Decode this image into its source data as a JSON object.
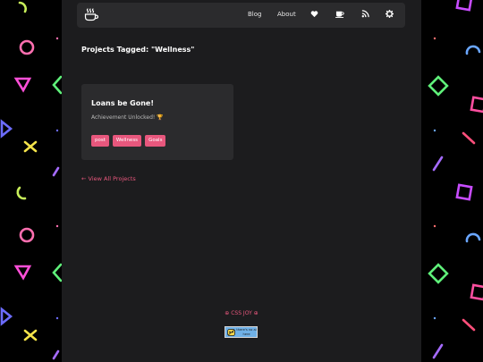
{
  "nav": {
    "links": [
      "Blog",
      "About"
    ],
    "icons": [
      "heart-icon",
      "coffee-icon",
      "rss-icon",
      "gear-icon"
    ]
  },
  "page_title": "Projects Tagged: \"Wellness\"",
  "card": {
    "title": "Loans be Gone!",
    "description": "Achievement Unlocked! 🏆",
    "tags": [
      "post",
      "Wellness",
      "Goals"
    ]
  },
  "view_all": "← View All Projects",
  "footer": {
    "text": "⊕ CSS JOY ⊕",
    "badge": "there's no ai here"
  },
  "colors": {
    "accent": "#e8577d",
    "panel": "#2b2b2d",
    "page_bg": "#1c1c1e",
    "badge_bg": "#6fb0e6"
  }
}
